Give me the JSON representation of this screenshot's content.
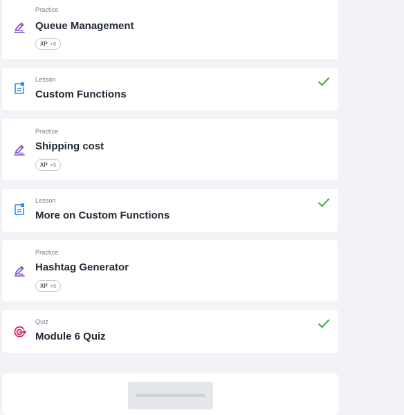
{
  "items": [
    {
      "kind": "Practice",
      "title": "Queue Management",
      "icon": "pencil-lines-icon",
      "xp_label": "XP",
      "xp_value": "+5",
      "completed": false
    },
    {
      "kind": "Lesson",
      "title": "Custom Functions",
      "icon": "lesson-document-icon",
      "completed": true
    },
    {
      "kind": "Practice",
      "title": "Shipping cost",
      "icon": "pencil-lines-icon",
      "xp_label": "XP",
      "xp_value": "+5",
      "completed": false
    },
    {
      "kind": "Lesson",
      "title": "More on Custom Functions",
      "icon": "lesson-document-icon",
      "completed": true
    },
    {
      "kind": "Practice",
      "title": "Hashtag Generator",
      "icon": "pencil-lines-icon",
      "xp_label": "XP",
      "xp_value": "+5",
      "completed": false
    },
    {
      "kind": "Quiz",
      "title": "Module 6 Quiz",
      "icon": "quiz-target-icon",
      "completed": true
    }
  ],
  "colors": {
    "practice_icon": "#7c4dca",
    "lesson_icon": "#1e90ff",
    "quiz_icon": "#e0245e",
    "check": "#44b14a",
    "background": "#f1f3f6"
  }
}
